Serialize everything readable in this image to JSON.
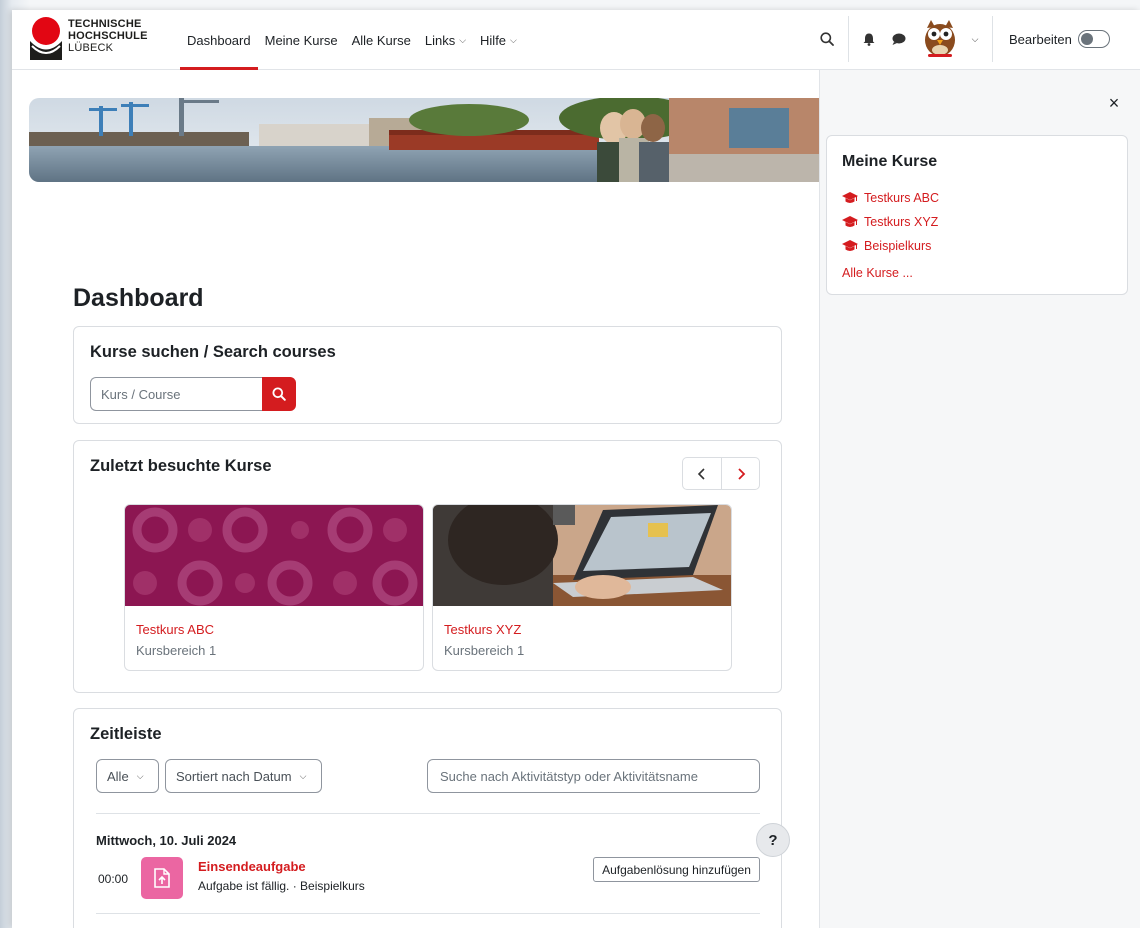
{
  "brand": {
    "line1": "TECHNISCHE",
    "line2": "HOCHSCHULE",
    "line3": "LÜBECK",
    "color": "#d41c1f"
  },
  "nav": {
    "items": [
      {
        "label": "Dashboard",
        "active": true
      },
      {
        "label": "Meine Kurse"
      },
      {
        "label": "Alle Kurse"
      },
      {
        "label": "Links",
        "dropdown": true
      },
      {
        "label": "Hilfe",
        "dropdown": true
      }
    ],
    "edit_label": "Bearbeiten",
    "icons": [
      "search-icon",
      "bell-icon",
      "chat-icon",
      "avatar",
      "chevron-down-icon"
    ]
  },
  "page": {
    "title": "Dashboard"
  },
  "course_search": {
    "title": "Kurse suchen / Search courses",
    "placeholder": "Kurs / Course"
  },
  "recent": {
    "title": "Zuletzt besuchte Kurse",
    "courses": [
      {
        "name": "Testkurs ABC",
        "category": "Kursbereich 1"
      },
      {
        "name": "Testkurs XYZ",
        "category": "Kursbereich 1"
      }
    ]
  },
  "timeline": {
    "title": "Zeitleiste",
    "filter": "Alle",
    "sort": "Sortiert nach Datum",
    "search_placeholder": "Suche nach Aktivitätstyp oder Aktivitätsname",
    "date": "Mittwoch, 10. Juli 2024",
    "event": {
      "time": "00:00",
      "name": "Einsendeaufgabe",
      "sub": "Aufgabe ist fällig. · Beispielkurs",
      "action": "Aufgabenlösung hinzufügen"
    }
  },
  "drawer": {
    "close": "×",
    "block_title": "Meine Kurse",
    "courses": [
      "Testkurs ABC",
      "Testkurs XYZ",
      "Beispielkurs"
    ],
    "all_link": "Alle Kurse ..."
  },
  "help": {
    "label": "?"
  }
}
